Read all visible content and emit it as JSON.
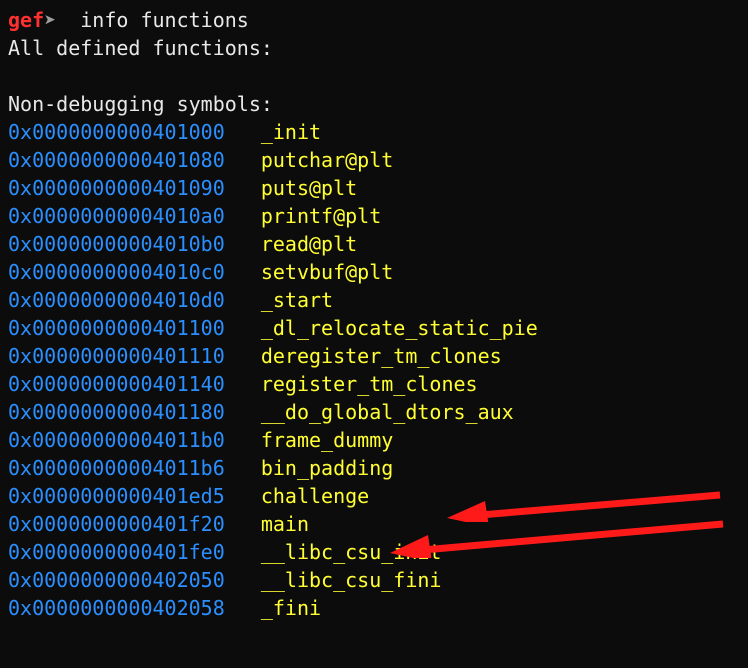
{
  "prompt": {
    "gef": "gef",
    "arrow": "➤",
    "command": "  info functions"
  },
  "header1": "All defined functions:",
  "header2": "Non-debugging symbols:",
  "symbols": [
    {
      "addr": "0x0000000000401000",
      "name": "_init"
    },
    {
      "addr": "0x0000000000401080",
      "name": "putchar@plt"
    },
    {
      "addr": "0x0000000000401090",
      "name": "puts@plt"
    },
    {
      "addr": "0x00000000004010a0",
      "name": "printf@plt"
    },
    {
      "addr": "0x00000000004010b0",
      "name": "read@plt"
    },
    {
      "addr": "0x00000000004010c0",
      "name": "setvbuf@plt"
    },
    {
      "addr": "0x00000000004010d0",
      "name": "_start"
    },
    {
      "addr": "0x0000000000401100",
      "name": "_dl_relocate_static_pie"
    },
    {
      "addr": "0x0000000000401110",
      "name": "deregister_tm_clones"
    },
    {
      "addr": "0x0000000000401140",
      "name": "register_tm_clones"
    },
    {
      "addr": "0x0000000000401180",
      "name": "__do_global_dtors_aux"
    },
    {
      "addr": "0x00000000004011b0",
      "name": "frame_dummy"
    },
    {
      "addr": "0x00000000004011b6",
      "name": "bin_padding"
    },
    {
      "addr": "0x0000000000401ed5",
      "name": "challenge"
    },
    {
      "addr": "0x0000000000401f20",
      "name": "main"
    },
    {
      "addr": "0x0000000000401fe0",
      "name": "__libc_csu_init"
    },
    {
      "addr": "0x0000000000402050",
      "name": "__libc_csu_fini"
    },
    {
      "addr": "0x0000000000402058",
      "name": "_fini"
    }
  ]
}
